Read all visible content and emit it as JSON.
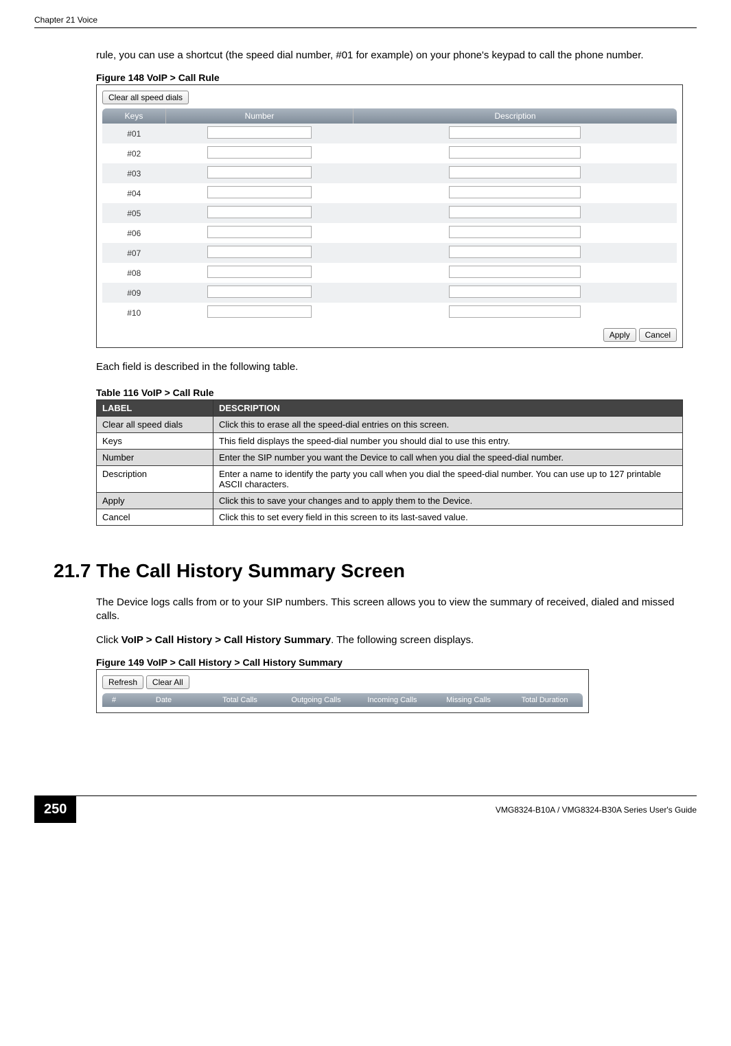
{
  "chapter_label": "Chapter 21 Voice",
  "intro_para": "rule, you can use a shortcut (the speed dial number, #01 for example) on your phone's keypad to call the phone number.",
  "figure148_caption": "Figure 148   VoIP > Call Rule",
  "speed_dial_ui": {
    "clear_btn": "Clear all speed dials",
    "headers": {
      "keys": "Keys",
      "number": "Number",
      "description": "Description"
    },
    "rows": [
      "#01",
      "#02",
      "#03",
      "#04",
      "#05",
      "#06",
      "#07",
      "#08",
      "#09",
      "#10"
    ],
    "apply": "Apply",
    "cancel": "Cancel"
  },
  "each_field_text": "Each field is described in the following table.",
  "table116_caption": "Table 116   VoIP > Call Rule",
  "table116": {
    "heads": {
      "label": "LABEL",
      "desc": "DESCRIPTION"
    },
    "rows": [
      {
        "label": "Clear all speed dials",
        "desc": "Click this to erase all the speed-dial entries on this screen."
      },
      {
        "label": "Keys",
        "desc": "This field displays the speed-dial number you should dial to use this entry."
      },
      {
        "label": "Number",
        "desc": "Enter the SIP number you want the Device to call when you dial the speed-dial number."
      },
      {
        "label": "Description",
        "desc": "Enter a name to identify the party you call when you dial the speed-dial number. You can use up to 127 printable ASCII characters."
      },
      {
        "label": "Apply",
        "desc": "Click this to save your changes and to apply them to the Device."
      },
      {
        "label": "Cancel",
        "desc": "Click this to set every field in this screen to its last-saved value."
      }
    ]
  },
  "section_head": "21.7  The Call History Summary Screen",
  "section_para1": "The Device logs calls from or to your SIP numbers. This screen allows you to view the summary of received, dialed and missed calls.",
  "section_para2_prefix": "Click ",
  "section_para2_bold": "VoIP > Call History > Call History Summary",
  "section_para2_suffix": ". The following screen displays.",
  "figure149_caption": "Figure 149   VoIP > Call History > Call History Summary",
  "history_ui": {
    "refresh": "Refresh",
    "clear_all": "Clear All",
    "cols": {
      "num": "#",
      "date": "Date",
      "total": "Total Calls",
      "out": "Outgoing Calls",
      "in": "Incoming Calls",
      "miss": "Missing Calls",
      "dur": "Total Duration"
    }
  },
  "page_number": "250",
  "footer_text": "VMG8324-B10A / VMG8324-B30A Series User's Guide"
}
